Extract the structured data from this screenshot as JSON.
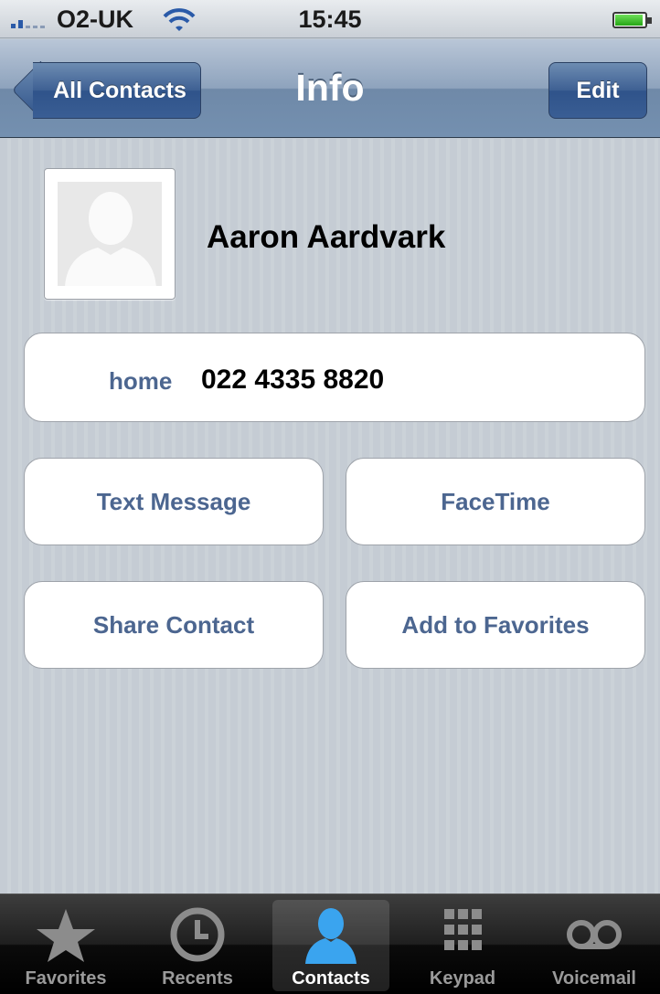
{
  "status_bar": {
    "carrier": "O2-UK",
    "time": "15:45"
  },
  "nav": {
    "back_label": "All Contacts",
    "title": "Info",
    "edit_label": "Edit"
  },
  "contact": {
    "name": "Aaron Aardvark",
    "phone": {
      "label": "home",
      "number": "022 4335 8820"
    }
  },
  "actions": {
    "text_message": "Text Message",
    "facetime": "FaceTime",
    "share_contact": "Share Contact",
    "add_to_favorites": "Add to Favorites"
  },
  "tabs": [
    {
      "label": "Favorites",
      "icon": "star-icon"
    },
    {
      "label": "Recents",
      "icon": "clock-icon"
    },
    {
      "label": "Contacts",
      "icon": "person-icon",
      "selected": true
    },
    {
      "label": "Keypad",
      "icon": "keypad-icon"
    },
    {
      "label": "Voicemail",
      "icon": "voicemail-icon"
    }
  ],
  "colors": {
    "accent_label": "#4c6690",
    "selected_tab_icon": "#3aa4ef"
  }
}
